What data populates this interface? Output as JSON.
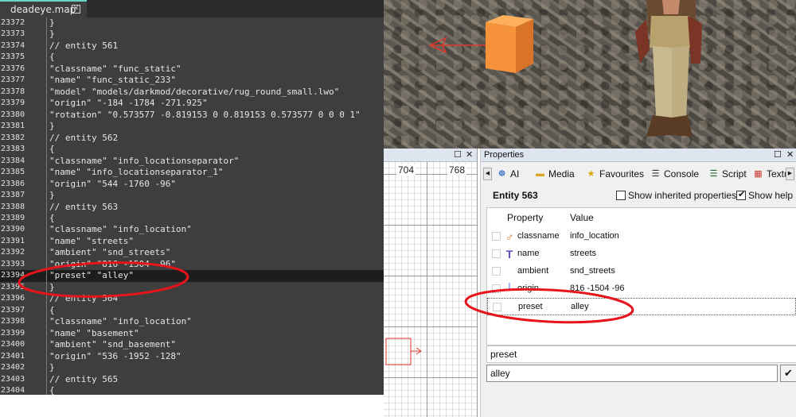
{
  "editor": {
    "tab_title": "deadeye.map",
    "tab_close_icon": "close-icon",
    "lines": [
      {
        "num": "23372",
        "text": "}"
      },
      {
        "num": "23373",
        "text": "}"
      },
      {
        "num": "23374",
        "text": "// entity 561"
      },
      {
        "num": "23375",
        "text": "{"
      },
      {
        "num": "23376",
        "text": "\"classname\" \"func_static\""
      },
      {
        "num": "23377",
        "text": "\"name\" \"func_static_233\""
      },
      {
        "num": "23378",
        "text": "\"model\" \"models/darkmod/decorative/rug_round_small.lwo\""
      },
      {
        "num": "23379",
        "text": "\"origin\" \"-184 -1784 -271.925\""
      },
      {
        "num": "23380",
        "text": "\"rotation\" \"0.573577 -0.819153 0 0.819153 0.573577 0 0 0 1\""
      },
      {
        "num": "23381",
        "text": "}"
      },
      {
        "num": "23382",
        "text": "// entity 562"
      },
      {
        "num": "23383",
        "text": "{"
      },
      {
        "num": "23384",
        "text": "\"classname\" \"info_locationseparator\""
      },
      {
        "num": "23385",
        "text": "\"name\" \"info_locationseparator_1\""
      },
      {
        "num": "23386",
        "text": "\"origin\" \"544 -1760 -96\""
      },
      {
        "num": "23387",
        "text": "}"
      },
      {
        "num": "23388",
        "text": "// entity 563"
      },
      {
        "num": "23389",
        "text": "{"
      },
      {
        "num": "23390",
        "text": "\"classname\" \"info_location\""
      },
      {
        "num": "23391",
        "text": "\"name\" \"streets\""
      },
      {
        "num": "23392",
        "text": "\"ambient\" \"snd_streets\""
      },
      {
        "num": "23393",
        "text": "\"origin\" \"816 -1504 -96\""
      },
      {
        "num": "23394",
        "text": "\"preset\" \"alley\"",
        "highlight": true
      },
      {
        "num": "23395",
        "text": "}"
      },
      {
        "num": "23396",
        "text": "// entity 564"
      },
      {
        "num": "23397",
        "text": "{"
      },
      {
        "num": "23398",
        "text": "\"classname\" \"info_location\""
      },
      {
        "num": "23399",
        "text": "\"name\" \"basement\""
      },
      {
        "num": "23400",
        "text": "\"ambient\" \"snd_basement\""
      },
      {
        "num": "23401",
        "text": "\"origin\" \"536 -1952 -128\""
      },
      {
        "num": "23402",
        "text": "}"
      },
      {
        "num": "23403",
        "text": "// entity 565"
      },
      {
        "num": "23404",
        "text": "{"
      }
    ]
  },
  "gridview": {
    "restore_icon": "restore-icon",
    "close_icon": "close-icon",
    "restore_glyph": "☐",
    "close_glyph": "✕",
    "labels": [
      "704",
      "768"
    ]
  },
  "properties": {
    "title": "Properties",
    "restore_glyph": "☐",
    "close_glyph": "✕",
    "tabs": [
      {
        "label": "AI",
        "icon": "ai-icon",
        "glyph": "☸",
        "color": "#1e5fbf"
      },
      {
        "label": "Media",
        "icon": "folder-icon",
        "glyph": "▬",
        "color": "#d9a520"
      },
      {
        "label": "Favourites",
        "icon": "star-icon",
        "glyph": "★",
        "color": "#e0a400"
      },
      {
        "label": "Console",
        "icon": "console-icon",
        "glyph": "☰",
        "color": "#333333"
      },
      {
        "label": "Script",
        "icon": "script-icon",
        "glyph": "☰",
        "color": "#1b6b2e"
      },
      {
        "label": "Textu",
        "icon": "texture-icon",
        "glyph": "▦",
        "color": "#c8372d"
      }
    ],
    "scroll_left": "◀",
    "scroll_right": "▶",
    "entity_title": "Entity 563",
    "show_inherited_label": "Show inherited properties",
    "show_inherited_checked": false,
    "show_help_label": "Show help",
    "show_help_checked": true,
    "columns": {
      "property": "Property",
      "value": "Value"
    },
    "rows": [
      {
        "name": "classname",
        "value": "info_location",
        "icon": "classname-icon",
        "glyph": "♂",
        "color": "#d9702a"
      },
      {
        "name": "name",
        "value": "streets",
        "icon": "text-icon",
        "glyph": "T",
        "color": "#6a45c9"
      },
      {
        "name": "ambient",
        "value": "snd_streets",
        "icon": "",
        "glyph": "",
        "color": "#000000"
      },
      {
        "name": "origin",
        "value": "816 -1504 -96",
        "icon": "axes-icon",
        "glyph": "└",
        "color": "#2e6fd6"
      },
      {
        "name": "preset",
        "value": "alley",
        "icon": "",
        "glyph": "",
        "color": "#000000",
        "selected": true
      }
    ],
    "key_field_value": "preset",
    "value_field_value": "alley",
    "apply_glyph": "✔"
  },
  "colors": {
    "annotation_red": "#e8141b",
    "editor_bg": "#3e3e3e",
    "tab_accent": "#6ad3c7",
    "crate_orange": "#f6923a"
  }
}
